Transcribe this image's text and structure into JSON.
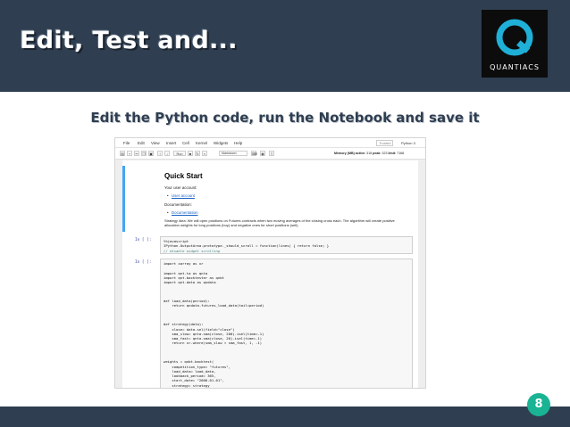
{
  "slide": {
    "title": "Edit, Test and...",
    "subtitle": "Edit the Python code, run the Notebook and save it",
    "page_number": "8"
  },
  "logo": {
    "text": "QUANTIACS",
    "icon": "quantiacs-q-logo"
  },
  "colors": {
    "header_bg": "#2f3e50",
    "accent": "#1ab394",
    "cell_accent": "#42a5f5"
  },
  "notebook": {
    "menu": [
      "File",
      "Edit",
      "View",
      "Insert",
      "Cell",
      "Kernel",
      "Widgets",
      "Help"
    ],
    "trusted": "Trusted",
    "kernel": "Python 3",
    "toolbar": {
      "run_label": "Run",
      "cell_type": "Markdown",
      "memory_label": "Memory (MB) active:",
      "memory_active": "318",
      "peak_label": "peak:",
      "memory_peak": "323",
      "limit_label": "limit:",
      "memory_limit": "7168"
    },
    "markdown": {
      "title": "Quick Start",
      "account_label": "Your user account:",
      "account_link": "User account",
      "doc_label": "Documentation:",
      "doc_link": "Documentation",
      "strategy_text": "Strategy idea: We will open positions on Futures contracts when two moving averages of the closing cross each. The algorithm will create positive allocation weights for long positions (buy) and negative ones for short positions (sell)."
    },
    "cell1": {
      "prompt": "In [ ]:",
      "lines": [
        "%%javascript",
        "IPython.OutputArea.prototype._should_scroll = function(lines) { return false; }",
        "// disable widget scrolling"
      ]
    },
    "cell2": {
      "prompt": "In [ ]:",
      "lines": [
        "import xarray as xr",
        "",
        "import qnt.ta as qnta",
        "import qnt.backtester as qnbt",
        "import qnt.data as qndata",
        "",
        "",
        "",
        "def load_data(period):",
        "    return qndata.futures_load_data(tail=period)",
        "",
        "",
        "",
        "def strategy(data):",
        "    close= data.sel(field=\"close\")",
        "    sma_slow= qnta.sma(close, 200).isel(time=-1)",
        "    sma_fast= qnta.sma(close, 20).isel(time=-1)",
        "    return xr.where(sma_slow < sma_fast, 1, -1)",
        "",
        "",
        "",
        "weights = qnbt.backtest(",
        "    competition_type= \"futures\",",
        "    load_data= load_data,",
        "    lookback_period= 365,",
        "    start_date= \"2006-01-01\",",
        "    strategy= strategy",
        ")"
      ]
    }
  }
}
